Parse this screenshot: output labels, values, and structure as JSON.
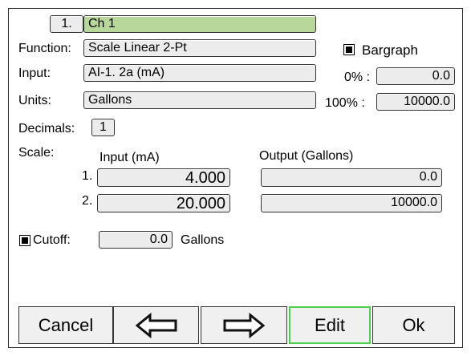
{
  "channel": {
    "number": "1.",
    "name": "Ch 1"
  },
  "function": {
    "label": "Function:",
    "value": "Scale Linear 2-Pt"
  },
  "input": {
    "label": "Input:",
    "value": "AI-1. 2a (mA)"
  },
  "units": {
    "label": "Units:",
    "value": "Gallons"
  },
  "bargraph": {
    "label": "Bargraph",
    "checked": true,
    "zero_label": "0% :",
    "zero_value": "0.0",
    "full_label": "100% :",
    "full_value": "10000.0"
  },
  "decimals": {
    "label": "Decimals:",
    "value": "1"
  },
  "scale": {
    "label": "Scale:",
    "input_header": "Input (mA)",
    "output_header": "Output (Gallons)",
    "rows": [
      {
        "index": "1.",
        "input": "4.000",
        "output": "0.0"
      },
      {
        "index": "2.",
        "input": "20.000",
        "output": "10000.0"
      }
    ]
  },
  "cutoff": {
    "label": "Cutoff:",
    "checked": true,
    "value": "0.0",
    "unit": "Gallons"
  },
  "buttons": {
    "cancel": "Cancel",
    "left_icon": "left-arrow-icon",
    "right_icon": "right-arrow-icon",
    "edit": "Edit",
    "ok": "Ok"
  },
  "colors": {
    "channel_field": "#b7d79b",
    "edit_border": "#4ccf4c",
    "field_bg": "#ececec"
  }
}
